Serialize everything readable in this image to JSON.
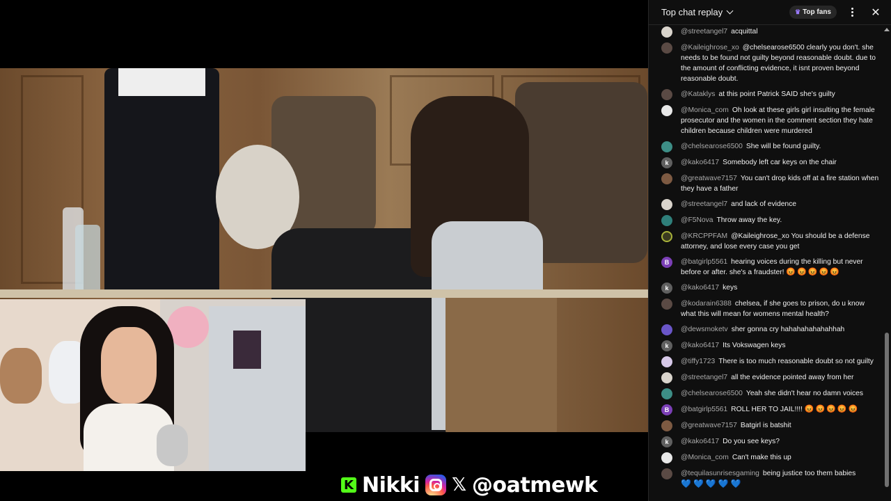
{
  "overlay": {
    "streamer_name": "Nikki",
    "handle": "@oatmewk"
  },
  "chat": {
    "header_title": "Top chat replay",
    "top_fans_label": "Top fans",
    "messages": [
      {
        "author": "@streetangel7",
        "text": "acquittal",
        "avatar": "white-dog-avatar"
      },
      {
        "author": "@Kaileighrose_xo",
        "text": "@chelsearose6500 clearly you don't. she needs to be found not guilty beyond reasonable doubt. due to the amount of conflicting evidence, it isnt proven beyond reasonable doubt.",
        "avatar": "photo-avatar"
      },
      {
        "author": "@Kataklys",
        "text": "at this point Patrick SAID she's guilty",
        "avatar": "photo-avatar"
      },
      {
        "author": "@Monica_com",
        "text": "Oh look at these girls girl insulting the female prosecutor and the women in the comment section they hate children because children were murdered",
        "avatar": "default-avatar"
      },
      {
        "author": "@chelsearose6500",
        "text": "She will be found guilty.",
        "avatar": "pattern-avatar"
      },
      {
        "author": "@kako6417",
        "text": "Somebody left car keys on the chair",
        "avatar": "letter-avatar",
        "letter": "k"
      },
      {
        "author": "@greatwave7157",
        "text": "You can't drop kids off at a fire station when they have a father",
        "avatar": "wave-avatar"
      },
      {
        "author": "@streetangel7",
        "text": "and lack of evidence",
        "avatar": "white-dog-avatar"
      },
      {
        "author": "@F5Nova",
        "text": "Throw away the key.",
        "avatar": "eye-avatar"
      },
      {
        "author": "@KRCPPFAM",
        "text": "@Kaileighrose_xo You should be a defense attorney, and lose every case you get",
        "avatar": "circle-avatar"
      },
      {
        "author": "@batgirlp5561",
        "text": "hearing voices during the killing but never before or after. she's a fraudster!",
        "emoji": "😡😡😡😡😡",
        "avatar": "letter-avatar",
        "letter": "B"
      },
      {
        "author": "@kako6417",
        "text": "keys",
        "avatar": "letter-avatar",
        "letter": "k"
      },
      {
        "author": "@kodarain6388",
        "text": "chelsea, if she goes to prison, do u know what this will mean for womens mental health?",
        "avatar": "photo-avatar"
      },
      {
        "author": "@dewsmoketv",
        "text": "sher gonna cry hahahahahahahhah",
        "avatar": "swirl-avatar"
      },
      {
        "author": "@kako6417",
        "text": "Its Vokswagen keys",
        "avatar": "letter-avatar",
        "letter": "k"
      },
      {
        "author": "@tiffy1723",
        "text": "There is too much reasonable doubt so not guilty",
        "avatar": "flower-avatar"
      },
      {
        "author": "@streetangel7",
        "text": "all the evidence pointed away from her",
        "avatar": "white-dog-avatar"
      },
      {
        "author": "@chelsearose6500",
        "text": "Yeah she didn't hear no damn voices",
        "avatar": "pattern-avatar"
      },
      {
        "author": "@batgirlp5561",
        "text": "ROLL HER TO JAIL!!!!",
        "emoji": "😡😡😡😡😡",
        "avatar": "letter-avatar",
        "letter": "B"
      },
      {
        "author": "@greatwave7157",
        "text": "Batgirl is batshit",
        "avatar": "wave-avatar"
      },
      {
        "author": "@kako6417",
        "text": "Do you see keys?",
        "avatar": "letter-avatar",
        "letter": "k"
      },
      {
        "author": "@Monica_com",
        "text": "Can't make this up",
        "avatar": "default-avatar"
      },
      {
        "author": "@tequilasunrisesgaming",
        "text": "being justice too them babies",
        "emoji": "💙💙💙💙💙",
        "avatar": "photo-avatar"
      }
    ]
  },
  "colors": {
    "chat_bg": "#0f0f0f",
    "author": "#aaaaaa",
    "message_text": "#f1f1f1",
    "kick_green": "#53fc18"
  }
}
